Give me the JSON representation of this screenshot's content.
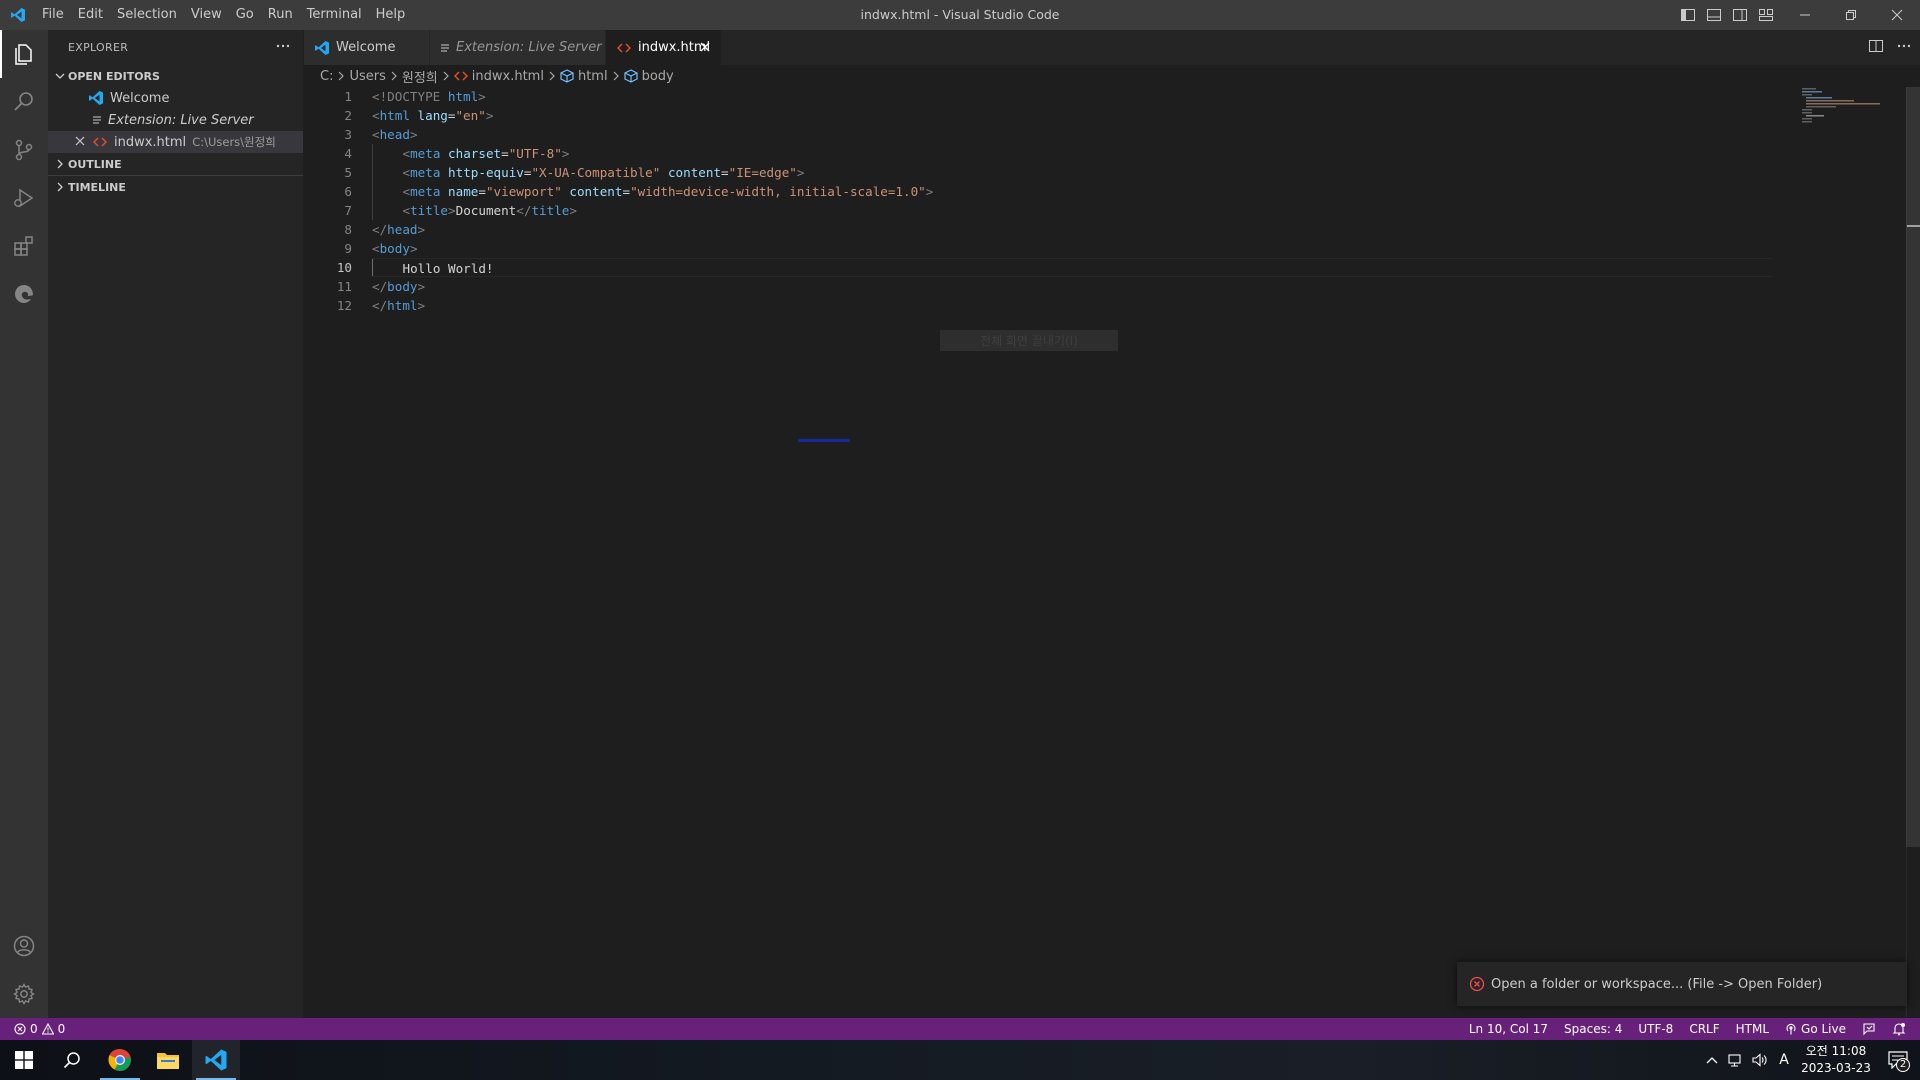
{
  "titlebar": {
    "title": "indwx.html - Visual Studio Code",
    "menus": [
      "File",
      "Edit",
      "Selection",
      "View",
      "Go",
      "Run",
      "Terminal",
      "Help"
    ]
  },
  "activitybar": {
    "top": [
      "explorer-icon",
      "search-icon",
      "source-control-icon",
      "run-debug-icon",
      "extensions-icon",
      "edge-devtools-icon"
    ],
    "bottom": [
      "account-icon",
      "manage-gear-icon"
    ]
  },
  "sidebar": {
    "title": "EXPLORER",
    "open_editors": {
      "label": "OPEN EDITORS",
      "items": [
        {
          "label": "Welcome",
          "path": ""
        },
        {
          "label": "Extension: Live Server",
          "path": ""
        },
        {
          "label": "indwx.html",
          "path": "C:\\Users\\원정희"
        }
      ]
    },
    "outline_label": "OUTLINE",
    "timeline_label": "TIMELINE"
  },
  "tabs": [
    {
      "label": "Welcome",
      "active": false
    },
    {
      "label": "Extension: Live Server",
      "active": false
    },
    {
      "label": "indwx.html",
      "active": true
    }
  ],
  "breadcrumb": {
    "parts": [
      "C:",
      "Users",
      "원정희",
      "indwx.html",
      "html",
      "body"
    ]
  },
  "editor": {
    "line_numbers": [
      "1",
      "2",
      "3",
      "4",
      "5",
      "6",
      "7",
      "8",
      "9",
      "10",
      "11",
      "12"
    ],
    "current_line": "10",
    "lines": {
      "l1": {
        "a": "<!DOCTYPE ",
        "b": "html",
        "c": ">"
      },
      "l2": {
        "a": "<",
        "b": "html",
        "c": " ",
        "d": "lang",
        "e": "=",
        "f": "\"en\"",
        "g": ">"
      },
      "l3": {
        "a": "<",
        "b": "head",
        "c": ">"
      },
      "l4": {
        "a": "<",
        "b": "meta",
        "c": " ",
        "d": "charset",
        "e": "=",
        "f": "\"UTF-8\"",
        "g": ">"
      },
      "l5": {
        "a": "<",
        "b": "meta",
        "c": " ",
        "d": "http-equiv",
        "e": "=",
        "f": "\"X-UA-Compatible\"",
        "g": " ",
        "h": "content",
        "i": "=",
        "j": "\"IE=edge\"",
        "k": ">"
      },
      "l6": {
        "a": "<",
        "b": "meta",
        "c": " ",
        "d": "name",
        "e": "=",
        "f": "\"viewport\"",
        "g": " ",
        "h": "content",
        "i": "=",
        "j": "\"width=device-width, initial-scale=1.0\"",
        "k": ">"
      },
      "l7": {
        "a": "<",
        "b": "title",
        "c": ">",
        "d": "Document",
        "e": "</",
        "f": "title",
        "g": ">"
      },
      "l8": {
        "a": "</",
        "b": "head",
        "c": ">"
      },
      "l9": {
        "a": "<",
        "b": "body",
        "c": ">"
      },
      "l10": {
        "a": "Hollo World!"
      },
      "l11": {
        "a": "</",
        "b": "body",
        "c": ">"
      },
      "l12": {
        "a": "</",
        "b": "html",
        "c": ">"
      }
    },
    "overlay_text": "전체 화면 끝내기(I)"
  },
  "notification": {
    "message": "Open a folder or workspace... (File -> Open Folder)"
  },
  "statusbar": {
    "errors": "0",
    "warnings": "0",
    "position": "Ln 10, Col 17",
    "spaces": "Spaces: 4",
    "encoding": "UTF-8",
    "eol": "CRLF",
    "language": "HTML",
    "go_live": "Go Live",
    "color": "#68217a"
  },
  "taskbar": {
    "apps": [
      "windows-start-icon",
      "search-icon",
      "chrome-icon",
      "file-explorer-icon",
      "vscode-icon"
    ],
    "time": "오전 11:08",
    "date": "2023-03-23",
    "ime": "A",
    "notification_count": "2"
  },
  "colors": {
    "accent": "#007acc",
    "html_icon": "#e44d26",
    "vscode_blue": "#23a9f2",
    "error_red": "#f14c4c"
  }
}
